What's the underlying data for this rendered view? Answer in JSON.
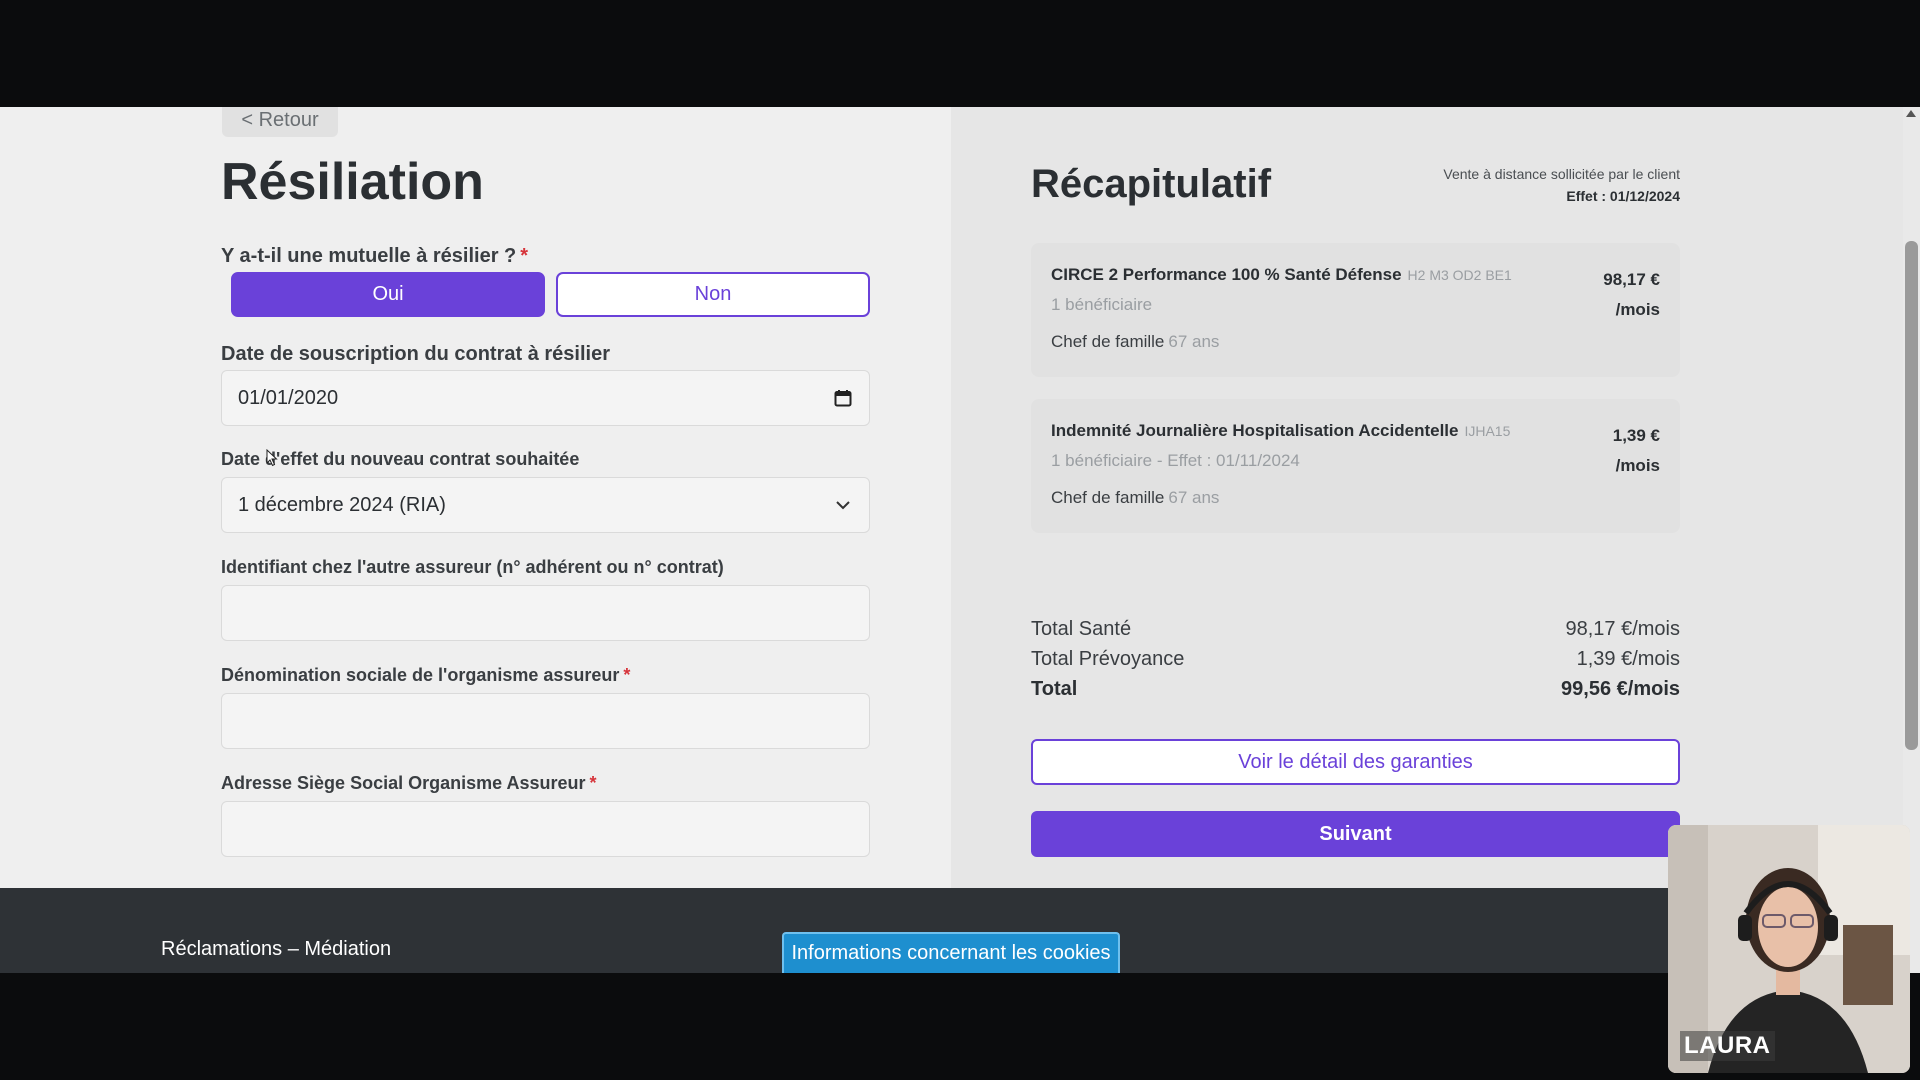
{
  "form": {
    "back_label": "< Retour",
    "title": "Résiliation",
    "question": "Y a-t-il une mutuelle à résilier ?",
    "required_mark": "*",
    "yes_label": "Oui",
    "no_label": "Non",
    "subscription_date_label": "Date de souscription du contrat à résilier",
    "subscription_date_value": "01/01/2020",
    "effect_date_label": "Date d'effet du nouveau contrat souhaitée",
    "effect_date_value": "1 décembre 2024 (RIA)",
    "insurer_id_label": "Identifiant chez l'autre assureur (n° adhérent ou n° contrat)",
    "insurer_id_value": "",
    "insurer_name_label": "Dénomination sociale de l'organisme assureur",
    "insurer_name_value": "",
    "insurer_address_label": "Adresse Siège Social Organisme Assureur",
    "insurer_address_value": ""
  },
  "recap": {
    "title": "Récapitulatif",
    "sale_mode": "Vente à distance sollicitée par le client",
    "effect": "Effet : 01/12/2024",
    "cards": [
      {
        "name": "CIRCE 2 Performance 100 % Santé Défense",
        "code": "H2 M3 OD2 BE1",
        "subtitle": "1 bénéficiaire",
        "role": "Chef de famille",
        "age": "67 ans",
        "price": "98,17 €",
        "period": "/mois"
      },
      {
        "name": "Indemnité Journalière Hospitalisation Accidentelle",
        "code": "IJHA15",
        "subtitle": "1 bénéficiaire - Effet : 01/11/2024",
        "role": "Chef de famille",
        "age": "67 ans",
        "price": "1,39 €",
        "period": "/mois"
      }
    ],
    "totals": [
      {
        "label": "Total Santé",
        "value": "98,17 €/mois"
      },
      {
        "label": "Total Prévoyance",
        "value": "1,39 €/mois"
      },
      {
        "label": "Total",
        "value": "99,56 €/mois"
      }
    ],
    "details_button": "Voir le détail des garanties",
    "next_button": "Suivant"
  },
  "footer": {
    "link": "Réclamations – Médiation",
    "cookies_button": "Informations concernant les cookies"
  },
  "webcam": {
    "participant_name": "LAURA"
  },
  "colors": {
    "accent": "#6a41d9",
    "required": "#d6333a",
    "cookie": "#1e8fcf",
    "footer": "#2e3236"
  },
  "icons": {
    "calendar": "calendar-icon",
    "dropdown": "chevron-down-icon",
    "cursor": "mouse-cursor-icon"
  }
}
